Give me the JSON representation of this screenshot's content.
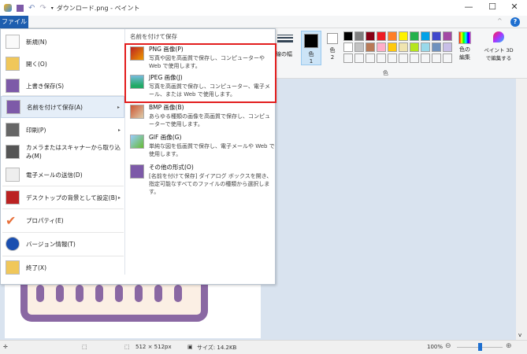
{
  "window": {
    "title": "ダウンロード.png - ペイント",
    "minimize": "—",
    "maximize": "☐",
    "close": "✕"
  },
  "file_tab": "ファイル",
  "menu": {
    "items": [
      {
        "label": "新規(N)",
        "icon": "new-file-icon"
      },
      {
        "label": "開く(O)",
        "icon": "open-folder-icon"
      },
      {
        "label": "上書き保存(S)",
        "icon": "save-icon"
      },
      {
        "label": "名前を付けて保存(A)",
        "icon": "save-as-icon",
        "submenu": true,
        "selected": true
      },
      {
        "label": "印刷(P)",
        "icon": "printer-icon",
        "submenu": true
      },
      {
        "label": "カメラまたはスキャナーから取り込み(M)",
        "icon": "scanner-icon"
      },
      {
        "label": "電子メールの送信(D)",
        "icon": "email-icon"
      },
      {
        "label": "デスクトップの背景として設定(B)",
        "icon": "desktop-icon",
        "submenu": true
      },
      {
        "label": "プロパティ(E)",
        "icon": "checkmark-icon"
      },
      {
        "label": "バージョン情報(T)",
        "icon": "info-icon"
      },
      {
        "label": "終了(X)",
        "icon": "exit-icon"
      }
    ],
    "submenu_header": "名前を付けて保存",
    "submenu": [
      {
        "title": "PNG 画像(P)",
        "desc": "写真や図を高画質で保存し、コンピューターや Web で使用します。"
      },
      {
        "title": "JPEG 画像(J)",
        "desc": "写真を高画質で保存し、コンピューター、電子メール、または Web で使用します。"
      },
      {
        "title": "BMP 画像(B)",
        "desc": "あらゆる種類の画像を高画質で保存し、コンピューターで使用します。"
      },
      {
        "title": "GIF 画像(G)",
        "desc": "単純な図を低画質で保存し、電子メールや Web で使用します。"
      },
      {
        "title": "その他の形式(O)",
        "desc": "[名前を付けて保存] ダイアログ ボックスを開き、指定可能なすべてのファイルの種類から選択します。"
      }
    ]
  },
  "ribbon": {
    "size_label": "線の幅",
    "color1": "色\n1",
    "color1_a": "色",
    "color1_b": "1",
    "color2_a": "色",
    "color2_b": "2",
    "edit_colors_a": "色の",
    "edit_colors_b": "編集",
    "paint3d_a": "ペイント 3D",
    "paint3d_b": "で編集する",
    "group_colors": "色",
    "palette_row1": [
      "#000000",
      "#7f7f7f",
      "#880015",
      "#ed1c24",
      "#ff7f27",
      "#fff200",
      "#22b14c",
      "#00a2e8",
      "#3f48cc",
      "#a349a4"
    ],
    "palette_row2": [
      "#ffffff",
      "#c3c3c3",
      "#b97a57",
      "#ffaec9",
      "#ffc90e",
      "#efe4b0",
      "#b5e61d",
      "#99d9ea",
      "#7092be",
      "#c8bfe7"
    ]
  },
  "status": {
    "dimensions": "512 × 512px",
    "size": "サイズ: 14.2KB",
    "zoom": "100%",
    "zoom_level": 0.5
  }
}
